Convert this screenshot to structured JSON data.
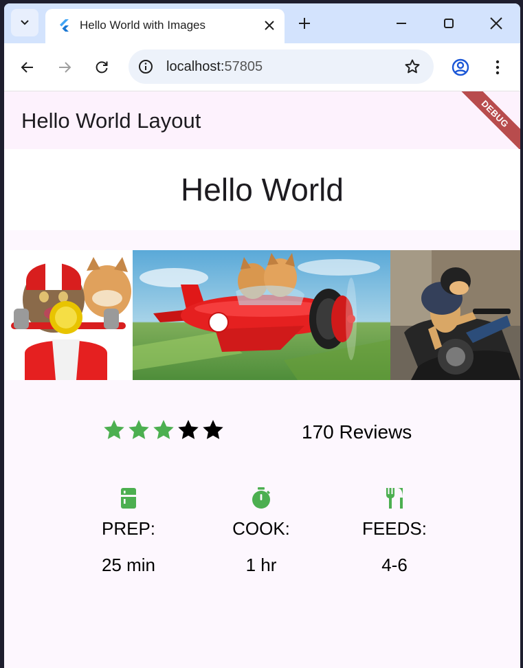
{
  "browser": {
    "tab_title": "Hello World with Images",
    "url_host": "localhost:",
    "url_port": "57805"
  },
  "app": {
    "appbar_title": "Hello World Layout",
    "debug_banner": "DEBUG",
    "headline": "Hello World"
  },
  "images": [
    {
      "name": "cat-scooter-helmet-image"
    },
    {
      "name": "cats-red-airplane-image"
    },
    {
      "name": "cat-motorbike-image"
    }
  ],
  "rating": {
    "stars_filled": 3,
    "stars_total": 5,
    "reviews_label": "170 Reviews"
  },
  "info": [
    {
      "icon": "kitchen-icon",
      "label": "PREP:",
      "value": "25 min"
    },
    {
      "icon": "timer-icon",
      "label": "COOK:",
      "value": "1 hr"
    },
    {
      "icon": "restaurant-icon",
      "label": "FEEDS:",
      "value": "4-6"
    }
  ],
  "colors": {
    "accent_green": "#4caf50",
    "star_off": "#000000",
    "tab_strip": "#d3e3fd",
    "page_bg": "#fdf7fe"
  }
}
